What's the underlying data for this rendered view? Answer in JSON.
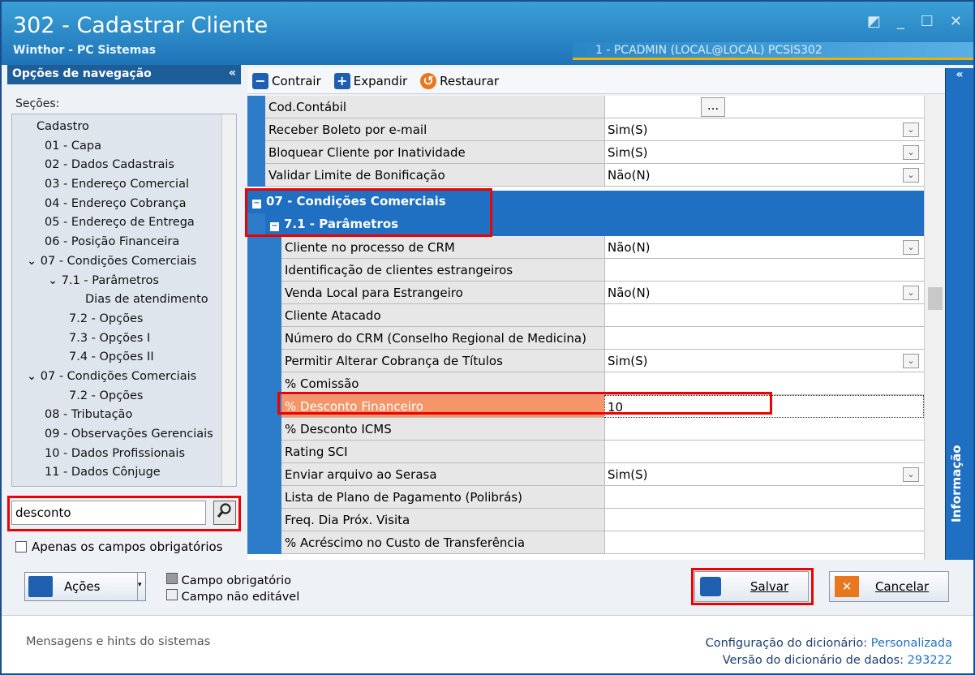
{
  "window": {
    "title": "302 - Cadastrar Cliente",
    "subtitle": "Winthor - PC Sistemas",
    "user_info": "1 - PCADMIN (LOCAL@LOCAL)   PCSIS302",
    "restore_icon": "◩",
    "minimize_icon": "_",
    "maximize_icon": "☐",
    "close_icon": "✕"
  },
  "nav": {
    "header": "Opções de navegação",
    "collapse": "«",
    "sections_label": "Seções:",
    "items": [
      "Cadastro",
      "01 - Capa",
      "02 - Dados Cadastrais",
      "03 - Endereço Comercial",
      "04 - Endereço Cobrança",
      "05 - Endereço de Entrega",
      "06 - Posição Financeira",
      "07 - Condições Comerciais",
      "7.1 - Parâmetros",
      "Dias de atendimento",
      "7.2 - Opções",
      "7.3 - Opções I",
      "7.4 - Opções II",
      "07 - Condições Comerciais",
      "7.2 - Opções",
      "08 - Tributação",
      "09 - Observações Gerenciais",
      "10 - Dados Profissionais",
      "11 - Dados Cônjuge"
    ],
    "search_value": "desconto",
    "only_required": "Apenas os campos obrigatórios"
  },
  "toolbar": {
    "contrair": "Contrair",
    "expandir": "Expandir",
    "restaurar": "Restaurar"
  },
  "grid": {
    "top_rows": [
      {
        "label": "Cod.Contábil",
        "value": "",
        "ellipsis": "..."
      },
      {
        "label": "Receber Boleto por e-mail",
        "value": "Sim(S)"
      },
      {
        "label": "Bloquear Cliente por Inatividade",
        "value": "Sim(S)"
      },
      {
        "label": "Validar Limite de Bonificação",
        "value": "Não(N)"
      }
    ],
    "category": "07 - Condições Comerciais",
    "subcategory": "7.1 - Parâmetros",
    "rows": [
      {
        "label": "Cliente no processo de CRM",
        "value": "Não(N)"
      },
      {
        "label": "Identificação de clientes estrangeiros",
        "value": ""
      },
      {
        "label": "Venda Local para Estrangeiro",
        "value": "Não(N)"
      },
      {
        "label": "Cliente Atacado",
        "value": ""
      },
      {
        "label": "Número do CRM (Conselho Regional de Medicina)",
        "value": ""
      },
      {
        "label": "Permitir Alterar Cobrança de Títulos",
        "value": "Sim(S)"
      },
      {
        "label": "% Comissão",
        "value": ""
      },
      {
        "label": "% Desconto Financeiro",
        "value": "10"
      },
      {
        "label": "% Desconto ICMS",
        "value": ""
      },
      {
        "label": "Rating SCI",
        "value": ""
      },
      {
        "label": "Enviar arquivo ao Serasa",
        "value": "Sim(S)"
      },
      {
        "label": "Lista de Plano de Pagamento (Polibrás)",
        "value": ""
      },
      {
        "label": "Freq. Dia Próx. Visita",
        "value": ""
      },
      {
        "label": "% Acréscimo no Custo de Transferência",
        "value": ""
      }
    ]
  },
  "side": {
    "collapse": "«",
    "info_label": "Informação"
  },
  "bottom": {
    "acoes": "Ações",
    "legend_required": "Campo obrigatório",
    "legend_noedit": "Campo não editável",
    "salvar": "Salvar",
    "cancelar": "Cancelar"
  },
  "status": {
    "hints": "Mensagens e hints do sistemas",
    "dict_config_label": "Configuração do dicionário:",
    "dict_config_value": "Personalizada",
    "dict_version_label": "Versão do dicionário de dados:",
    "dict_version_value": "293222"
  }
}
